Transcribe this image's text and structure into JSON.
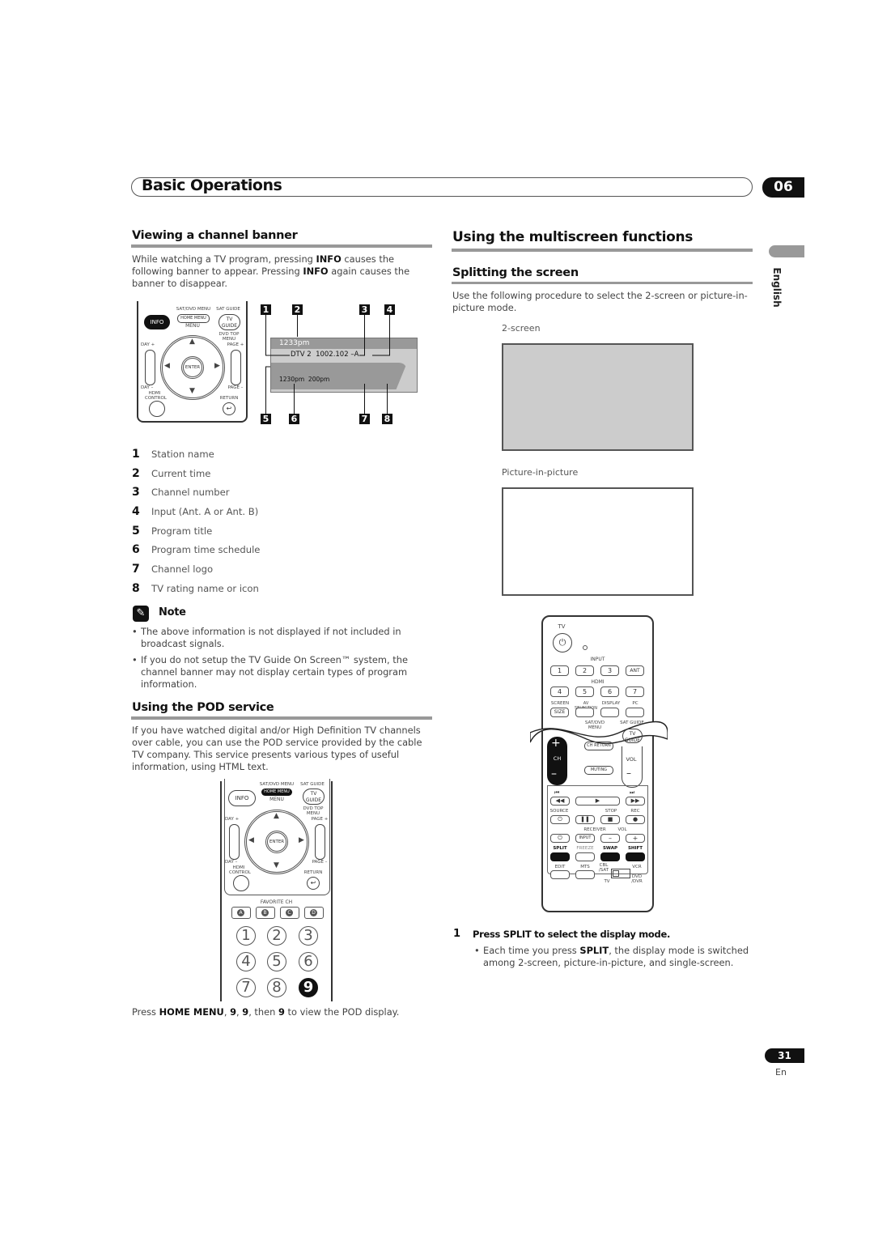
{
  "header": {
    "chapter_title": "Basic Operations",
    "chapter_number": "06"
  },
  "side_tab": {
    "language": "English"
  },
  "left": {
    "section1": {
      "title": "Viewing a channel banner",
      "intro_parts": [
        "While watching a TV program, pressing ",
        "INFO",
        " causes the following banner to appear. Pressing ",
        "INFO",
        " again causes the banner to disappear."
      ]
    },
    "remote1": {
      "info": "INFO",
      "sat_dvd_menu": "SAT/DVD MENU",
      "home_menu": "HOME MENU",
      "menu": "MENU",
      "sat_guide": "SAT GUIDE",
      "tv": "TV",
      "guide": "GUIDE",
      "dvd_top_menu": "DVD TOP MENU",
      "day_plus": "DAY +",
      "day_minus": "DAY –",
      "page_plus": "PAGE +",
      "page_minus": "PAGE –",
      "enter": "ENTER",
      "hdmi_control": "HDMI CONTROL",
      "return": "RETURN"
    },
    "banner": {
      "current_time": "1233pm",
      "station_line": "DTV 2  1002.102 –A",
      "schedule": "1230pm  200pm",
      "markers": [
        "1",
        "2",
        "3",
        "4",
        "5",
        "6",
        "7",
        "8"
      ]
    },
    "legend": [
      {
        "num": "1",
        "label": "Station name"
      },
      {
        "num": "2",
        "label": "Current time"
      },
      {
        "num": "3",
        "label": "Channel number"
      },
      {
        "num": "4",
        "label": "Input (Ant. A or Ant. B)"
      },
      {
        "num": "5",
        "label": "Program title"
      },
      {
        "num": "6",
        "label": "Program time schedule"
      },
      {
        "num": "7",
        "label": "Channel logo"
      },
      {
        "num": "8",
        "label": "TV rating name or icon"
      }
    ],
    "note": {
      "title": "Note",
      "items": [
        "The above information is not displayed if not included in broadcast signals.",
        "If you do not setup the TV Guide On Screen™ system, the channel banner may not display certain types of program information."
      ]
    },
    "section2": {
      "title": "Using the POD service",
      "body": "If you have watched digital and/or High Definition TV channels over cable, you can use the POD service provided by the cable TV company. This service presents various types of useful information, using HTML text."
    },
    "remote2": {
      "favorite_ch": "FAVORITE CH",
      "fav_buttons": [
        "A",
        "B",
        "C",
        "D"
      ],
      "numbers": [
        "1",
        "2",
        "3",
        "4",
        "5",
        "6",
        "7",
        "8",
        "9"
      ]
    },
    "caption_parts": [
      "Press ",
      "HOME MENU",
      ", ",
      "9",
      ", ",
      "9",
      ", then ",
      "9",
      " to view the POD display."
    ]
  },
  "right": {
    "title": "Using the multiscreen functions",
    "subsection": {
      "title": "Splitting the screen",
      "intro": "Use the following procedure to select the 2-screen or picture-in-picture mode."
    },
    "figure1_label": "2-screen",
    "figure2_label": "Picture-in-picture",
    "remote3": {
      "tv": "TV",
      "input": "INPUT",
      "input_buttons": [
        "1",
        "2",
        "3",
        "ANT"
      ],
      "hdmi": "HDMI",
      "hdmi_buttons": [
        "4",
        "5",
        "6",
        "7"
      ],
      "row_labels": [
        "SCREEN",
        "AV SELECTION",
        "DISPLAY",
        "PC"
      ],
      "size": "SIZE",
      "sat_dvd_menu": "SAT/DVD MENU",
      "sat_guide": "SAT GUIDE",
      "menu": "MENU",
      "tv_guide": "TV GUIDE",
      "ch": "CH",
      "ch_return": "CH RETURN",
      "muting": "MUTING",
      "vol": "VOL",
      "source": "SOURCE",
      "stop": "STOP",
      "rec": "REC",
      "receiver": "RECEIVER",
      "vol2": "VOL",
      "input_small": "INPUT",
      "bottom_labels": [
        "SPLIT",
        "FREEZE",
        "SWAP",
        "SHIFT"
      ],
      "edit": "EDIT",
      "mts": "MTS",
      "cbl_sat": "CBL /SAT",
      "vcr": "VCR",
      "tv_small": "TV",
      "dvd_dvr": "DVD /DVR"
    },
    "step": {
      "num": "1",
      "text": "Press SPLIT to select the display mode.",
      "bullet_parts": [
        "Each time you press ",
        "SPLIT",
        ", the display mode is switched among 2-screen, picture-in-picture, and single-screen."
      ]
    }
  },
  "footer": {
    "page_number": "31",
    "lang_code": "En"
  }
}
